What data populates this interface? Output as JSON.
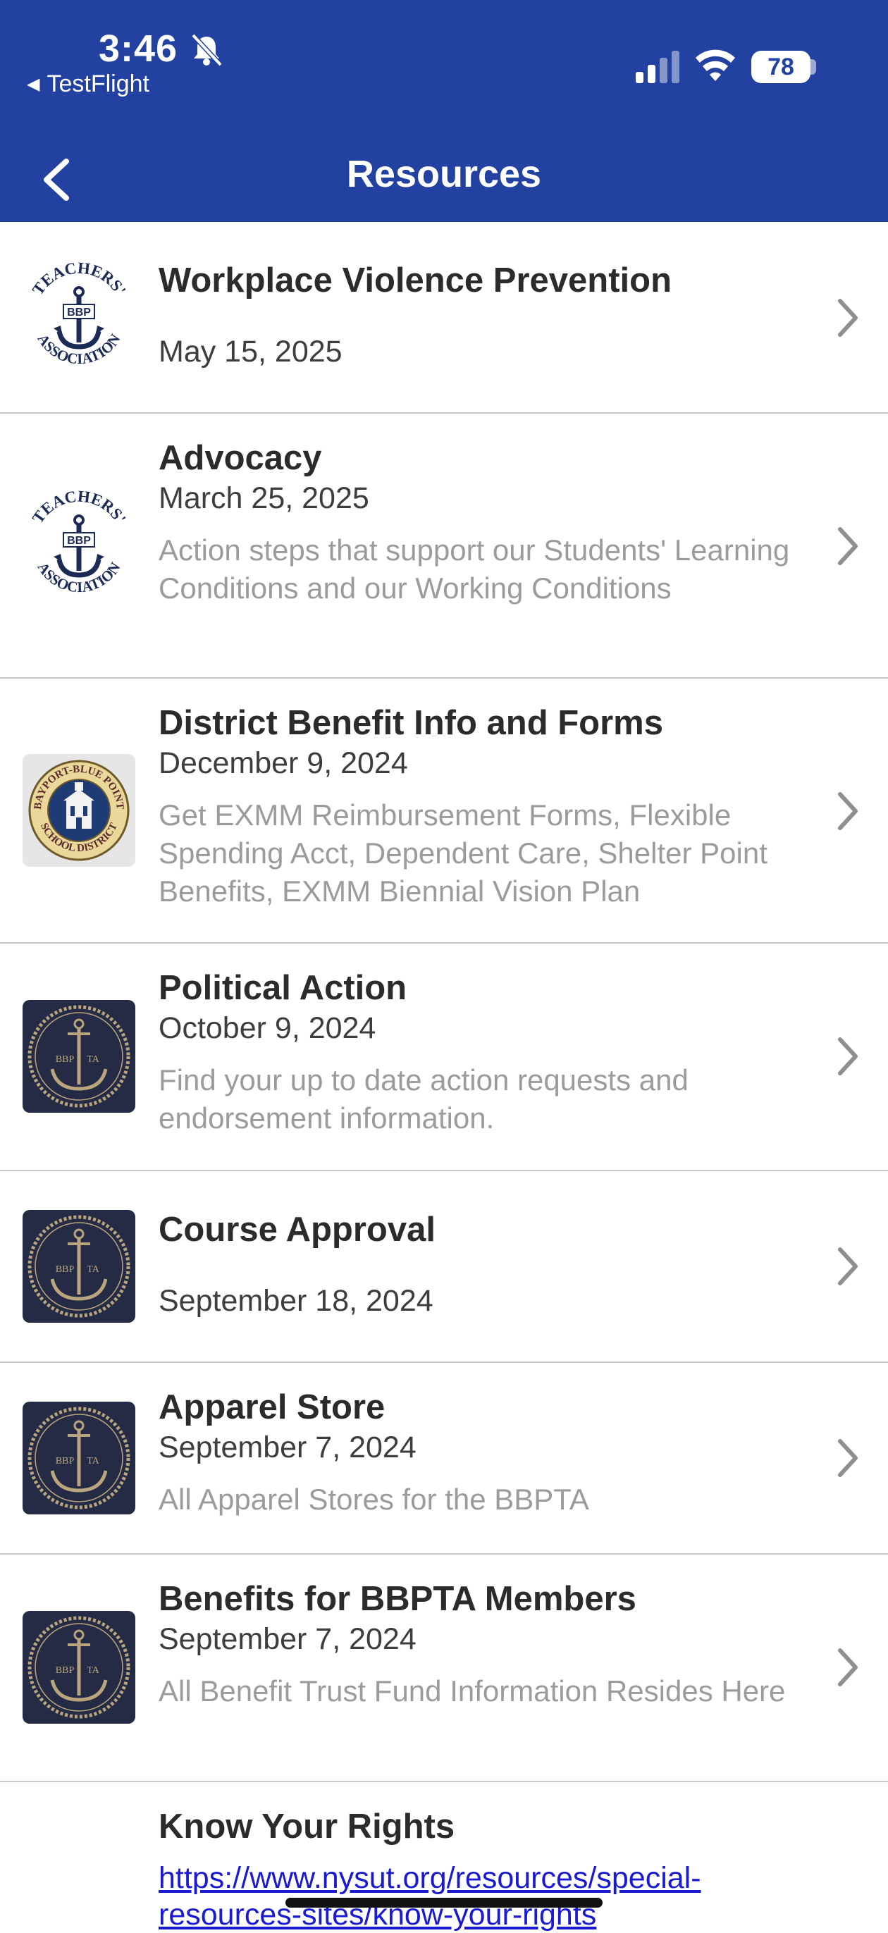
{
  "status_bar": {
    "time": "3:46",
    "back_app": "TestFlight",
    "battery": "78"
  },
  "nav": {
    "title": "Resources"
  },
  "items": [
    {
      "title": "Workplace Violence Prevention",
      "date": "May 15, 2025",
      "description": "",
      "logo": "teachers-association-anchor-logo"
    },
    {
      "title": "Advocacy",
      "date": "March 25, 2025",
      "description": "Action steps that support our Students' Learning Conditions and our Working Conditions",
      "logo": "teachers-association-anchor-logo"
    },
    {
      "title": "District Benefit Info and Forms",
      "date": "December 9, 2024",
      "description": "Get EXMM Reimbursement Forms, Flexible Spending Acct, Dependent Care, Shelter Point Benefits, EXMM Biennial Vision Plan",
      "logo": "school-district-seal"
    },
    {
      "title": "Political Action",
      "date": "October 9, 2024",
      "description": "Find your up to date action requests and endorsement information.",
      "logo": "bbpta-anchor-badge"
    },
    {
      "title": "Course Approval",
      "date": "September 18, 2024",
      "description": "",
      "logo": "bbpta-anchor-badge"
    },
    {
      "title": "Apparel Store",
      "date": "September 7, 2024",
      "description": "All Apparel Stores for the BBPTA",
      "logo": "bbpta-anchor-badge"
    },
    {
      "title": "Benefits for BBPTA Members",
      "date": "September 7, 2024",
      "description": "All Benefit Trust Fund Information Resides Here",
      "logo": "bbpta-anchor-badge"
    },
    {
      "title": "Know Your Rights",
      "link_line1": "https://www.nysut.org/resources/special-",
      "link_line2": "resources-sites/know-your-rights"
    }
  ],
  "logos": {
    "teachers_top": "TEACHERS'",
    "teachers_mid": "BBP",
    "teachers_bottom": "ASSOCIATION",
    "district_top": "BAYPORT-BLUE POINT",
    "district_bottom": "SCHOOL DISTRICT",
    "bbpta_left": "BBP",
    "bbpta_right": "TA"
  },
  "colors": {
    "header": "#2241a0",
    "link": "#1a1ad0",
    "badge": "#262b45",
    "gold": "#b9a57e"
  }
}
